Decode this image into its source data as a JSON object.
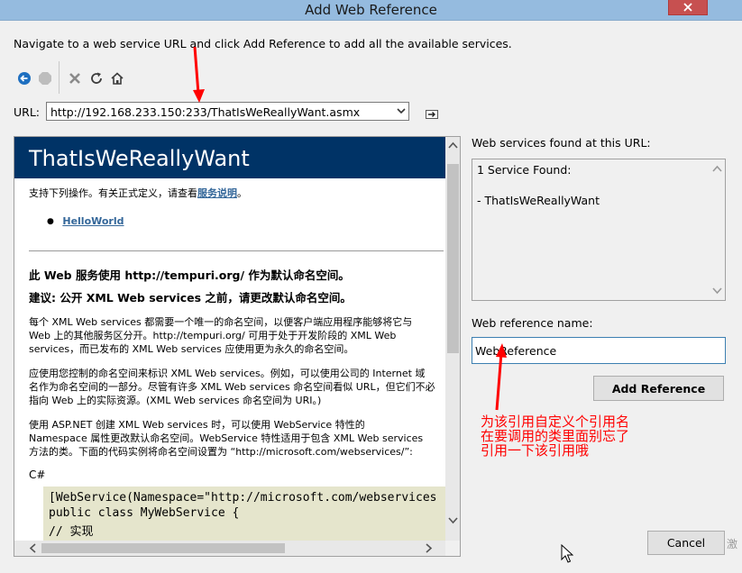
{
  "window": {
    "title": "Add Web Reference"
  },
  "instruction": "Navigate to a web service URL and click Add Reference to add all the available services.",
  "toolbar": {
    "icons": [
      "back-arrow-icon",
      "stop-icon",
      "delete-icon",
      "refresh-icon",
      "home-icon"
    ]
  },
  "url": {
    "label": "URL:",
    "value": "http://192.168.233.150:233/ThatIsWeReallyWant.asmx"
  },
  "browser": {
    "service_title": "ThatIsWeReallyWant",
    "intro_text": "支持下列操作。有关正式定义，请查看",
    "intro_link": "服务说明",
    "intro_end": "。",
    "operation": "HelloWorld",
    "namespace_heading": "此  Web 服务使用  http://tempuri.org/ 作为默认命名空间。",
    "recommendation_heading": "建议: 公开  XML Web services 之前，请更改默认命名空间。",
    "paragraph1": [
      "每个  XML Web services 都需要一个唯一的命名空间，以便客户端应用程序能够将它与",
      "Web 上的其他服务区分开。http://tempuri.org/ 可用于处于开发阶段的  XML Web",
      "services，而已发布的  XML Web services 应使用更为永久的命名空间。"
    ],
    "paragraph2": [
      "应使用您控制的命名空间来标识  XML Web services。例如，可以使用公司的  Internet 域",
      "名作为命名空间的一部分。尽管有许多  XML Web services 命名空间看似  URL，但它们不必",
      "指向  Web 上的实际资源。(XML Web services 命名空间为  URI。)"
    ],
    "paragraph3": [
      "使用  ASP.NET 创建  XML Web services 时，可以使用  WebService 特性的",
      "Namespace 属性更改默认命名空间。WebService 特性适用于包含  XML Web services",
      "方法的类。下面的代码实例将命名空间设置为 “http://microsoft.com/webservices/”:"
    ],
    "code_lang": "C#",
    "code_lines": [
      "[WebService(Namespace=\"http://microsoft.com/webservices",
      "public class MyWebService {",
      "    // 实现"
    ]
  },
  "found": {
    "label": "Web services found at this URL:",
    "count_text": "1 Service Found:",
    "service_item": "- ThatIsWeReallyWant"
  },
  "reference": {
    "label": "Web reference name:",
    "value": "WebReference"
  },
  "buttons": {
    "add_reference": "Add Reference",
    "cancel": "Cancel"
  },
  "annotation": {
    "lines": [
      "为该引用自定义个引用名",
      "在要调用的类里面别忘了",
      "引用一下该引用哦"
    ],
    "color": "#ff0000"
  },
  "watermark": "激"
}
